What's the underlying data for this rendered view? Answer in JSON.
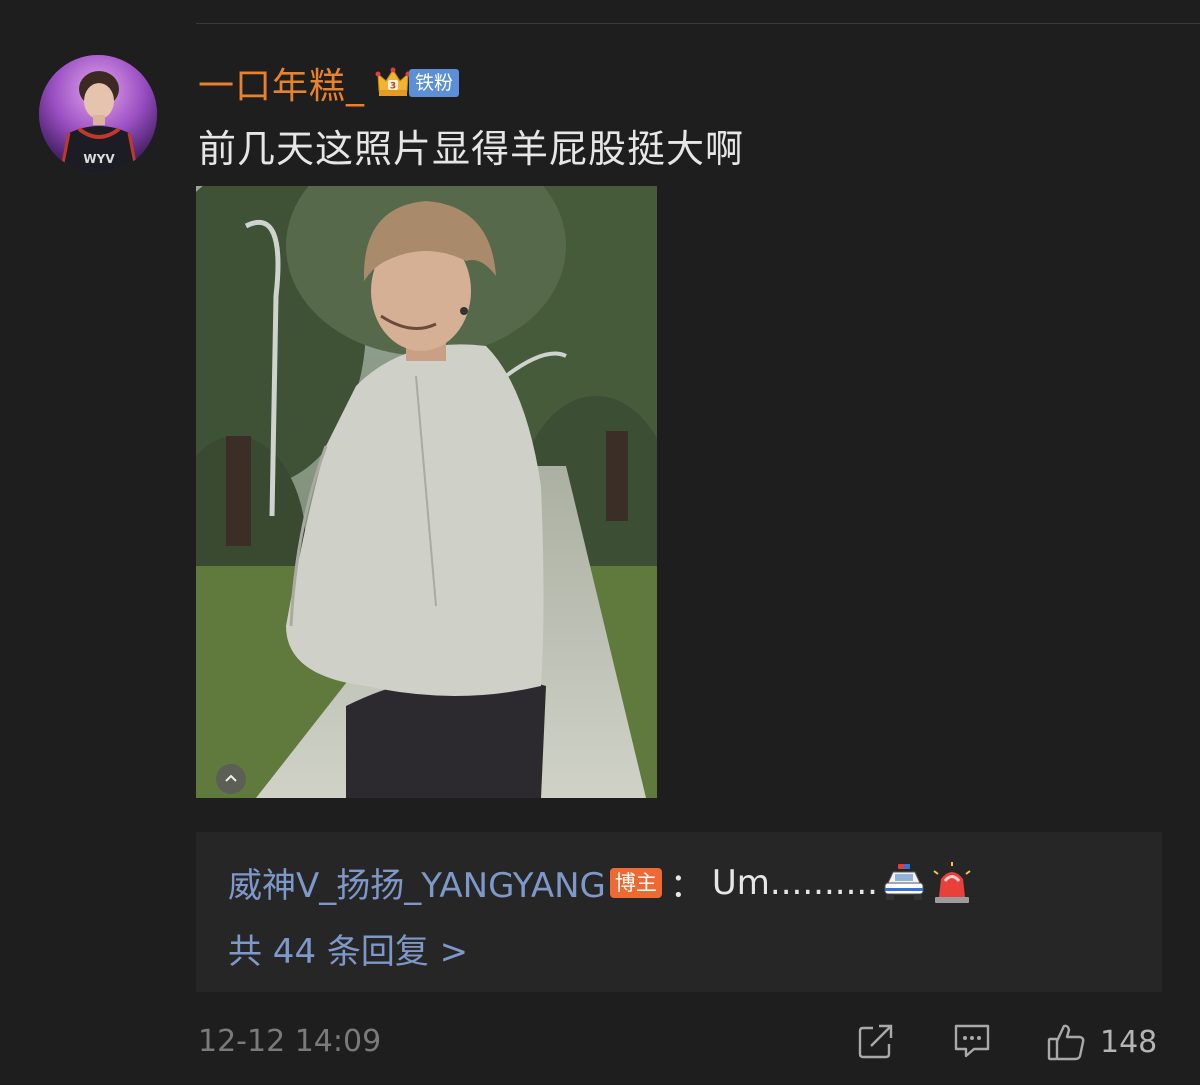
{
  "comment": {
    "username": "一口年糕_",
    "fan_badge": "铁粉",
    "text": "前几天这照片显得羊屁股挺大啊",
    "timestamp": "12-12 14:09",
    "like_count": "148"
  },
  "reply": {
    "author": "威神V_扬扬_YANGYANG",
    "author_badge": "博主",
    "separator": "：",
    "content": "Um..........",
    "emojis": [
      "police-car-icon",
      "siren-icon"
    ],
    "more_replies": "共 44 条回复 >"
  },
  "icons": {
    "crown": "crown-level-icon",
    "collapse": "chevron-up-icon",
    "share": "share-icon",
    "comment": "comment-icon",
    "like": "thumbs-up-icon"
  },
  "colors": {
    "background": "#1e1e1e",
    "username": "#e8832c",
    "link_blue": "#7e98c9",
    "fan_badge": "#5b8fd8",
    "blogger_badge": "#ee6a33"
  }
}
